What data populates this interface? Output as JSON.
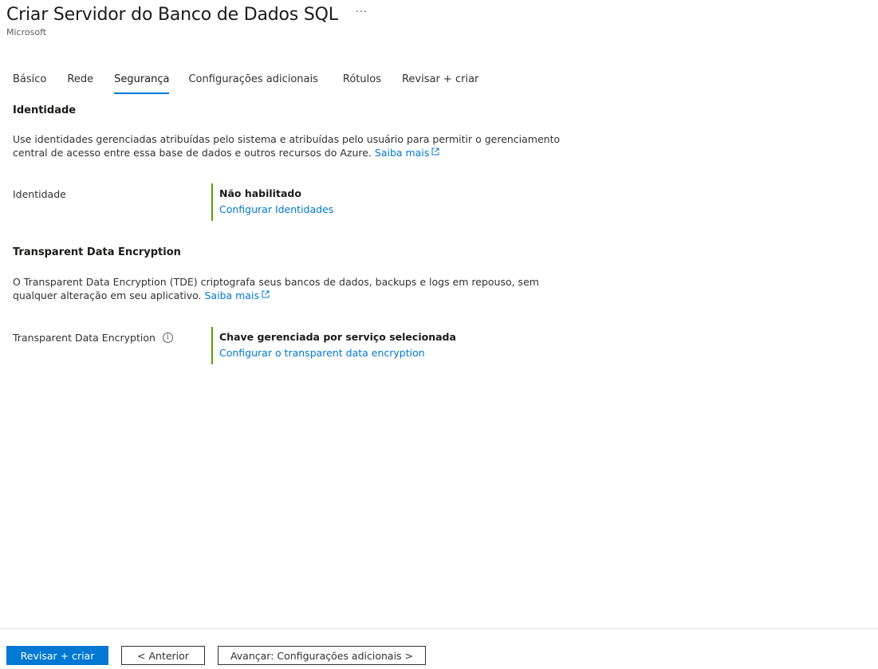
{
  "header": {
    "title": "Criar Servidor do Banco de Dados SQL",
    "more_label": "···",
    "subtitle": "Microsoft"
  },
  "tabs": [
    {
      "label": "Básico",
      "active": false
    },
    {
      "label": "Rede",
      "active": false
    },
    {
      "label": "Segurança",
      "active": true
    },
    {
      "label": "Configurações adicionais",
      "active": false
    },
    {
      "label": "Rótulos",
      "active": false
    },
    {
      "label": "Revisar + criar",
      "active": false
    }
  ],
  "identity_section": {
    "title": "Identidade",
    "description": "Use identidades gerenciadas atribuídas pelo sistema e atribuídas pelo usuário para permitir o gerenciamento central de acesso entre essa base de dados e outros recursos do Azure.",
    "learn_more": "Saiba mais",
    "field_label": "Identidade",
    "value": "Não habilitado",
    "configure_link": "Configurar Identidades"
  },
  "tde_section": {
    "title": "Transparent Data Encryption",
    "description": "O Transparent Data Encryption (TDE) criptografa seus bancos de dados, backups e logs em repouso, sem qualquer alteração em seu aplicativo.",
    "learn_more": "Saiba mais",
    "field_label": "Transparent Data Encryption",
    "info_icon": "i",
    "value": "Chave gerenciada por serviço selecionada",
    "configure_link": "Configurar o transparent data encryption"
  },
  "footer": {
    "primary_button": "Revisar + criar",
    "previous_button": "< Anterior",
    "next_button": "Avançar: Configurações adicionais >"
  },
  "colors": {
    "accent": "#0078d4",
    "status_green": "#57a300"
  }
}
